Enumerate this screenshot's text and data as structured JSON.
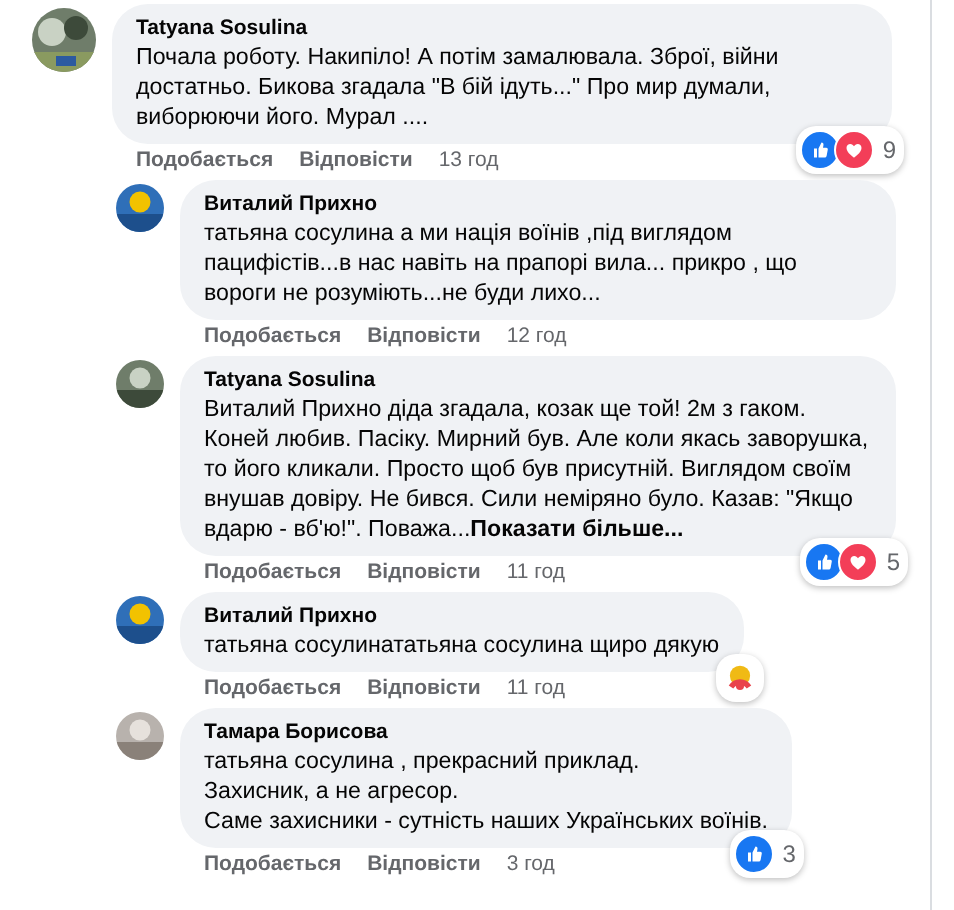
{
  "comments": [
    {
      "author": "Tatyana Sosulina",
      "lines": [
        "Почала роботу. Накипіло! А потім замалювала. Зброї, війни достатньо. Бикова згадала \"В бій ідуть...\" Про мир думали, виборюючи його. Мурал ...."
      ],
      "like": "Подобається",
      "reply": "Відповісти",
      "time": "13 год",
      "reactions": {
        "like": true,
        "love": true,
        "count": "9"
      },
      "replies": [
        {
          "author": "Виталий Прихно",
          "lines": [
            "татьяна сосулина а ми нація воїнів ,під виглядом пацифістів...в нас навіть на прапорі вила... прикро , що вороги не розуміють...не буди лихо..."
          ],
          "like": "Подобається",
          "reply": "Відповісти",
          "time": "12 год"
        },
        {
          "author": "Tatyana Sosulina",
          "lines": [
            "Виталий Прихно діда згадала, козак ще той! 2м з гаком. Коней любив. Пасіку. Мирний був. Але коли якась заворушка, то його кликали. Просто щоб був присутній. Виглядом своїм внушав довіру. Не бився. Сили неміряно було. Казав: \"Якщо вдарю - вб'ю!\". Поважа..."
          ],
          "more": "Показати більше...",
          "like": "Подобається",
          "reply": "Відповісти",
          "time": "11 год",
          "reactions": {
            "like": true,
            "love": true,
            "count": "5"
          }
        },
        {
          "author": "Виталий Прихно",
          "lines": [
            "татьяна сосулинататьяна сосулина щиро дякую"
          ],
          "like": "Подобається",
          "reply": "Відповісти",
          "time": "11 год",
          "reactions": {
            "care": true
          }
        },
        {
          "author": "Тамара Борисова",
          "lines": [
            "татьяна сосулина , прекрасний приклад.",
            "Захисник, а не агресор.",
            "Саме захисники - сутність наших Українських воїнів."
          ],
          "like": "Подобається",
          "reply": "Відповісти",
          "time": "3 год",
          "reactions": {
            "like": true,
            "count": "3"
          }
        }
      ]
    }
  ]
}
